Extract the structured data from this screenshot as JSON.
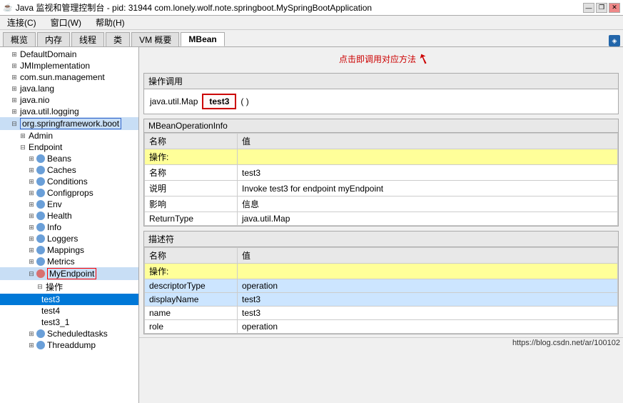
{
  "window": {
    "title": "Java 监视和管理控制台 - pid: 31944 com.lonely.wolf.note.springboot.MySpringBootApplication",
    "minimize": "—",
    "restore": "❐",
    "close": "✕"
  },
  "menu": {
    "items": [
      "连接(C)",
      "窗口(W)",
      "帮助(H)"
    ]
  },
  "tabs": [
    {
      "label": "概览",
      "active": false
    },
    {
      "label": "内存",
      "active": false
    },
    {
      "label": "线程",
      "active": false
    },
    {
      "label": "类",
      "active": false
    },
    {
      "label": "VM 概要",
      "active": false
    },
    {
      "label": "MBean",
      "active": true
    }
  ],
  "sidebar": {
    "items": [
      {
        "label": "DefaultDomain",
        "indent": 1,
        "type": "expand",
        "expanded": true
      },
      {
        "label": "JMImplementation",
        "indent": 1,
        "type": "expand",
        "expanded": false
      },
      {
        "label": "com.sun.management",
        "indent": 1,
        "type": "expand",
        "expanded": false
      },
      {
        "label": "java.lang",
        "indent": 1,
        "type": "expand",
        "expanded": false
      },
      {
        "label": "java.nio",
        "indent": 1,
        "type": "expand",
        "expanded": false
      },
      {
        "label": "java.util.logging",
        "indent": 1,
        "type": "expand",
        "expanded": false
      },
      {
        "label": "org.springframework.boot",
        "indent": 1,
        "type": "expand",
        "expanded": true,
        "highlighted": true
      },
      {
        "label": "Admin",
        "indent": 2,
        "type": "expand",
        "expanded": false
      },
      {
        "label": "Endpoint",
        "indent": 2,
        "type": "expand",
        "expanded": true
      },
      {
        "label": "Beans",
        "indent": 3,
        "type": "gear",
        "expanded": false
      },
      {
        "label": "Caches",
        "indent": 3,
        "type": "gear",
        "expanded": false
      },
      {
        "label": "Conditions",
        "indent": 3,
        "type": "gear",
        "expanded": false
      },
      {
        "label": "Configprops",
        "indent": 3,
        "type": "gear",
        "expanded": false
      },
      {
        "label": "Env",
        "indent": 3,
        "type": "gear",
        "expanded": false
      },
      {
        "label": "Health",
        "indent": 3,
        "type": "gear",
        "expanded": false
      },
      {
        "label": "Info",
        "indent": 3,
        "type": "gear",
        "expanded": false
      },
      {
        "label": "Loggers",
        "indent": 3,
        "type": "gear",
        "expanded": false
      },
      {
        "label": "Mappings",
        "indent": 3,
        "type": "gear",
        "expanded": false
      },
      {
        "label": "Metrics",
        "indent": 3,
        "type": "gear",
        "expanded": false
      },
      {
        "label": "MyEndpoint",
        "indent": 3,
        "type": "gear",
        "expanded": true,
        "selected": true
      },
      {
        "label": "操作",
        "indent": 4,
        "type": "expand",
        "expanded": true
      },
      {
        "label": "test3",
        "indent": 5,
        "type": "leaf",
        "selected": true
      },
      {
        "label": "test4",
        "indent": 5,
        "type": "leaf"
      },
      {
        "label": "test3_1",
        "indent": 5,
        "type": "leaf"
      },
      {
        "label": "Scheduledtasks",
        "indent": 3,
        "type": "gear",
        "expanded": false
      },
      {
        "label": "Threaddump",
        "indent": 3,
        "type": "gear",
        "expanded": false
      }
    ]
  },
  "annotation": {
    "text": "点击即调用对应方法",
    "arrow": "↙"
  },
  "ops_section": {
    "title": "操作调用",
    "return_type": "java.util.Map",
    "button_label": "test3",
    "paren": "( )"
  },
  "mbean_section": {
    "title": "MBeanOperationInfo",
    "col_name": "名称",
    "col_value": "值",
    "rows": [
      {
        "name": "操作:",
        "value": "",
        "style": "yellow"
      },
      {
        "name": "名称",
        "value": "test3",
        "style": "white"
      },
      {
        "name": "说明",
        "value": "Invoke test3 for endpoint myEndpoint",
        "style": "white"
      },
      {
        "name": "影响",
        "value": "信息",
        "style": "white"
      },
      {
        "name": "ReturnType",
        "value": "java.util.Map",
        "style": "white"
      }
    ]
  },
  "descriptor_section": {
    "title": "描述符",
    "col_name": "名称",
    "col_value": "值",
    "rows": [
      {
        "name": "操作:",
        "value": "",
        "style": "yellow"
      },
      {
        "name": "descriptorType",
        "value": "operation",
        "style": "blue"
      },
      {
        "name": "displayName",
        "value": "test3",
        "style": "blue"
      },
      {
        "name": "name",
        "value": "test3",
        "style": "white"
      },
      {
        "name": "role",
        "value": "operation",
        "style": "white"
      }
    ]
  },
  "status_bar": {
    "url": "https://blog.csdn.net/ar/100102"
  },
  "colors": {
    "highlight_blue": "#99ccff",
    "selected_blue": "#0078d7",
    "row_yellow": "#ffff99",
    "row_blue": "#cce5ff",
    "gear_blue": "#6a9fd8",
    "gear_red": "#d87070",
    "border_red": "#cc0000",
    "network_icon": "#2266aa"
  }
}
